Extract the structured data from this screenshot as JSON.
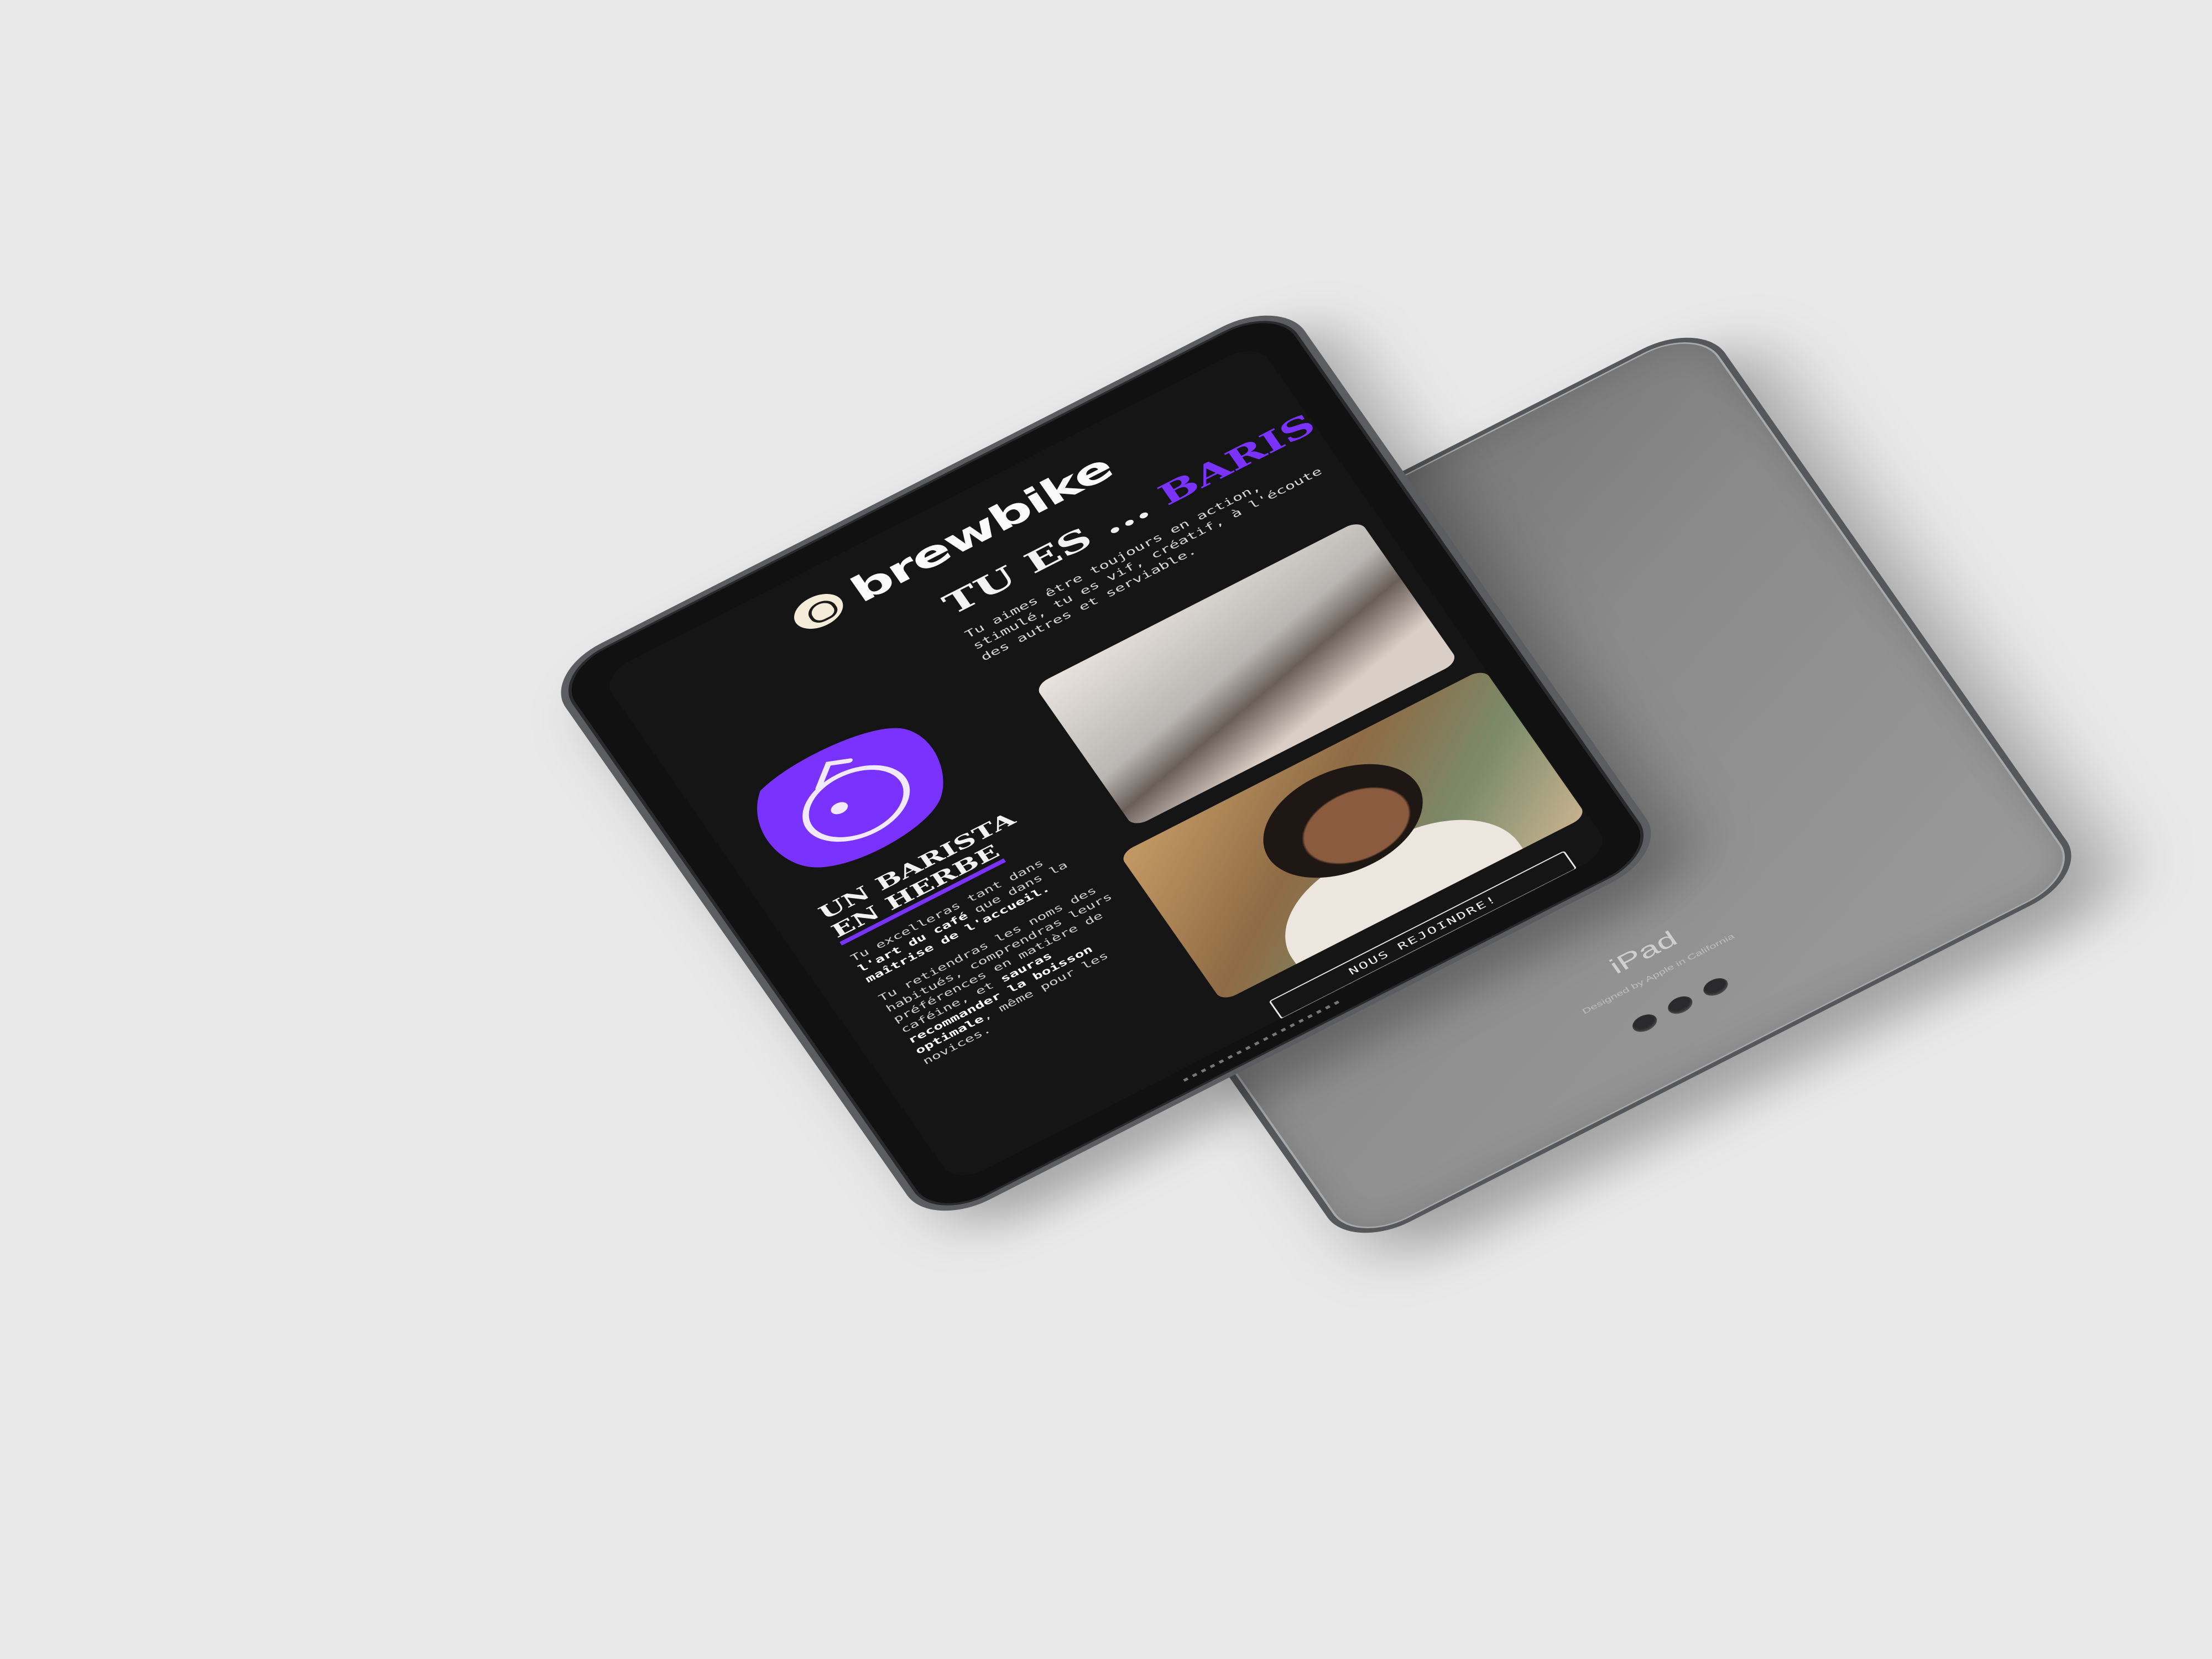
{
  "brand": {
    "name": "brewbike"
  },
  "screen": {
    "headline_prefix": "TU ES ...",
    "headline_role": "BARISTA",
    "intro": "Tu aimes être toujours en action, stimulé, tu es vif, créatif, à l'écoute des autres et serviable.",
    "tag_line1": "UN BARISTA",
    "tag_line2": "EN HERBE",
    "body_p1_a": "Tu excelleras tant dans ",
    "body_p1_b": "l'art du café",
    "body_p1_c": " que dans la ",
    "body_p1_d": "maîtrise de l'accueil.",
    "body_p2_a": "Tu retiendras les noms des habitués, comprendras leurs préférences en matière de caféine, et ",
    "body_p2_b": "sauras recommander la boisson optimale",
    "body_p2_c": ", même pour les novices.",
    "cta_label": "NOUS REJOINDRE!"
  },
  "device_back": {
    "model": "iPad",
    "subtitle": "Designed by Apple in California"
  },
  "colors": {
    "accent": "#7a33ff",
    "background": "#e9e9e9",
    "screen": "#151515",
    "aluminum": "#8a8a8a"
  },
  "icons": [
    "brewbike-logo-icon",
    "barista-illustration-icon",
    "apple-logo-icon",
    "smart-connector-icon",
    "camera-icon"
  ]
}
